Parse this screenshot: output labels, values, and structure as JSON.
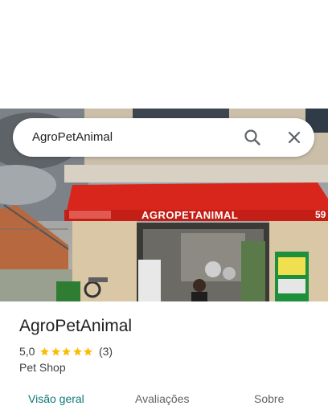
{
  "search": {
    "value": "AgroPetAnimal"
  },
  "photo": {
    "awning_text": "AGROPETANIMAL",
    "awning_number": "59"
  },
  "place": {
    "name": "AgroPetAnimal",
    "rating_value": "5,0",
    "stars": 5,
    "review_count": "(3)",
    "category": "Pet Shop"
  },
  "tabs": [
    {
      "label": "Visão geral",
      "active": true
    },
    {
      "label": "Avaliações",
      "active": false
    },
    {
      "label": "Sobre",
      "active": false
    }
  ],
  "colors": {
    "accent": "#0b7a75",
    "star": "#fbbc04",
    "awning": "#d9261c"
  }
}
